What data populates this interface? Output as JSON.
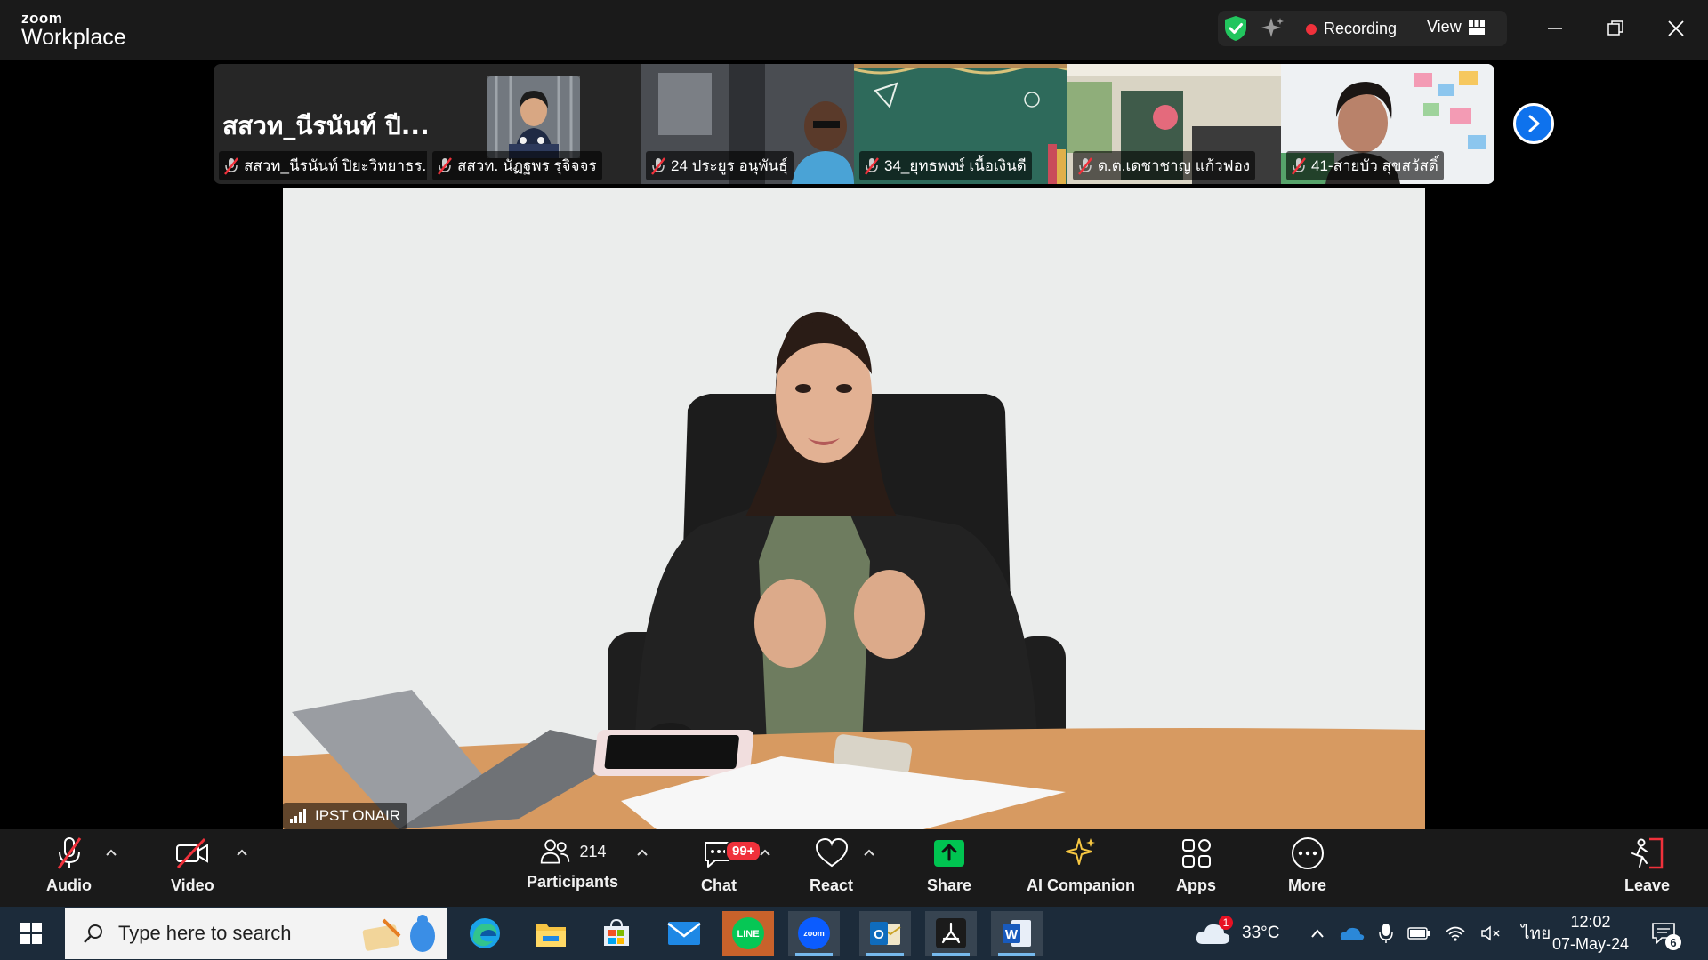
{
  "app": {
    "brand_top": "zoom",
    "brand_bottom": "Workplace"
  },
  "topbar": {
    "recording_label": "Recording",
    "view_label": "View"
  },
  "gallery": {
    "big_name": "สสวท_นีรนันท์ ปี...",
    "tiles": [
      {
        "name": "สสวท_นีรนันท์ ปิยะวิทยาธร..."
      },
      {
        "name": "สสวท. นัฏฐพร รุจิจจร"
      },
      {
        "name": "24 ประยูร อนุพันธุ์"
      },
      {
        "name": "34_ยุทธพงษ์ เนื้อเงินดี"
      },
      {
        "name": "ด.ต.เดชาชาญ   แก้วฟอง"
      },
      {
        "name": "41-สายบัว สุขสวัสดิ์"
      }
    ]
  },
  "main_video": {
    "name": "IPST ONAIR"
  },
  "toolbar": {
    "audio": "Audio",
    "video": "Video",
    "participants": "Participants",
    "participants_count": "214",
    "chat": "Chat",
    "chat_badge": "99+",
    "react": "React",
    "share": "Share",
    "ai_companion": "AI Companion",
    "apps": "Apps",
    "more": "More",
    "leave": "Leave",
    "share_color": "#00c451",
    "leave_color": "#f0313b"
  },
  "taskbar": {
    "search_placeholder": "Type here to search",
    "weather_temp": "33°C",
    "weather_badge": "1",
    "language": "ไทย",
    "time": "12:02",
    "date": "07-May-24",
    "notification_count": "6"
  }
}
